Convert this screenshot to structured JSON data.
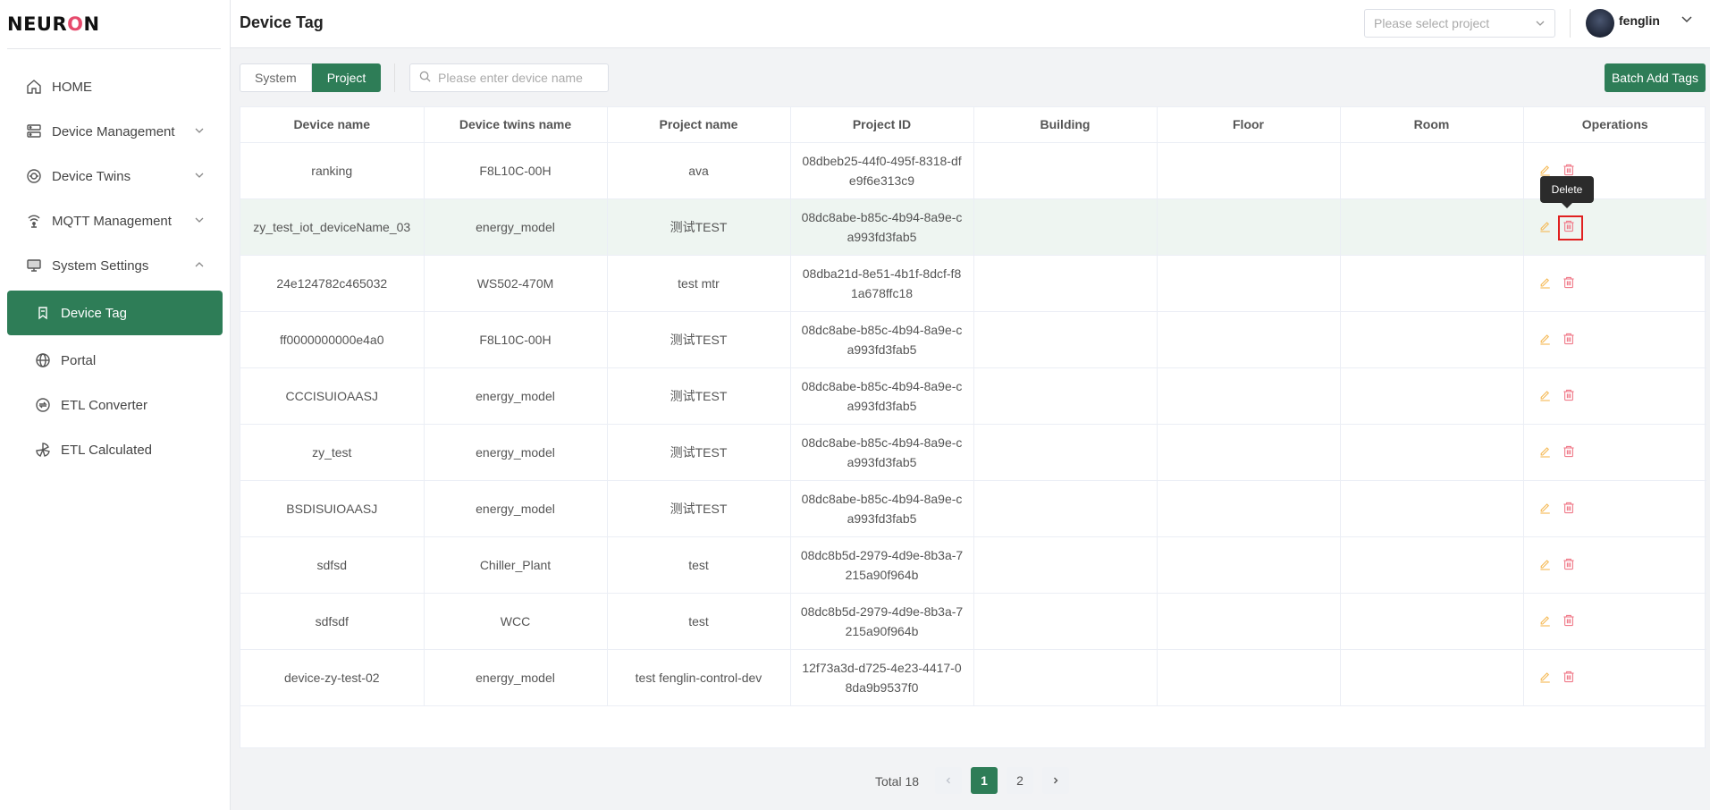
{
  "app": {
    "logo_text_a": "NEUR",
    "logo_text_b": "O",
    "logo_text_c": "N"
  },
  "header": {
    "title": "Device Tag",
    "project_placeholder": "Please select project",
    "username": "fenglin"
  },
  "sidebar": {
    "items": [
      {
        "label": "HOME",
        "icon": "home-icon"
      },
      {
        "label": "Device Management",
        "icon": "server-icon"
      },
      {
        "label": "Device Twins",
        "icon": "twins-icon"
      },
      {
        "label": "MQTT Management",
        "icon": "mqtt-icon"
      },
      {
        "label": "System Settings",
        "icon": "monitor-icon"
      },
      {
        "label": "Device Tag",
        "icon": "tag-icon"
      },
      {
        "label": "Portal",
        "icon": "globe-icon"
      },
      {
        "label": "ETL Converter",
        "icon": "converter-icon"
      },
      {
        "label": "ETL Calculated",
        "icon": "calculated-icon"
      }
    ]
  },
  "toolbar": {
    "tab_system": "System",
    "tab_project": "Project",
    "search_placeholder": "Please enter device name",
    "batch_add_label": "Batch Add Tags"
  },
  "table": {
    "columns": [
      "Device name",
      "Device twins name",
      "Project name",
      "Project ID",
      "Building",
      "Floor",
      "Room",
      "Operations"
    ],
    "rows": [
      [
        "ranking",
        "F8L10C-00H",
        "ava",
        "08dbeb25-44f0-495f-8318-dfe9f6e313c9",
        "",
        "",
        ""
      ],
      [
        "zy_test_iot_deviceName_03",
        "energy_model",
        "测试TEST",
        "08dc8abe-b85c-4b94-8a9e-ca993fd3fab5",
        "",
        "",
        ""
      ],
      [
        "24e124782c465032",
        "WS502-470M",
        "test mtr",
        "08dba21d-8e51-4b1f-8dcf-f81a678ffc18",
        "",
        "",
        ""
      ],
      [
        "ff0000000000e4a0",
        "F8L10C-00H",
        "测试TEST",
        "08dc8abe-b85c-4b94-8a9e-ca993fd3fab5",
        "",
        "",
        ""
      ],
      [
        "CCCISUIOAASJ",
        "energy_model",
        "测试TEST",
        "08dc8abe-b85c-4b94-8a9e-ca993fd3fab5",
        "",
        "",
        ""
      ],
      [
        "zy_test",
        "energy_model",
        "测试TEST",
        "08dc8abe-b85c-4b94-8a9e-ca993fd3fab5",
        "",
        "",
        ""
      ],
      [
        "BSDISUIOAASJ",
        "energy_model",
        "测试TEST",
        "08dc8abe-b85c-4b94-8a9e-ca993fd3fab5",
        "",
        "",
        ""
      ],
      [
        "sdfsd",
        "Chiller_Plant",
        "test",
        "08dc8b5d-2979-4d9e-8b3a-7215a90f964b",
        "",
        "",
        ""
      ],
      [
        "sdfsdf",
        "WCC",
        "test",
        "08dc8b5d-2979-4d9e-8b3a-7215a90f964b",
        "",
        "",
        ""
      ],
      [
        "device-zy-test-02",
        "energy_model",
        "test fenglin-control-dev",
        "12f73a3d-d725-4e23-4417-08da9b9537f0",
        "",
        "",
        ""
      ]
    ],
    "ops": {
      "edit_icon": "edit-icon",
      "delete_icon": "delete-icon"
    }
  },
  "tooltip": {
    "text": "Delete"
  },
  "pagination": {
    "total_label": "Total 18",
    "pages": [
      "1",
      "2"
    ],
    "current": "1"
  },
  "colors": {
    "accent": "#2e7d57",
    "edit": "#f5b955",
    "delete": "#f07b8a"
  }
}
